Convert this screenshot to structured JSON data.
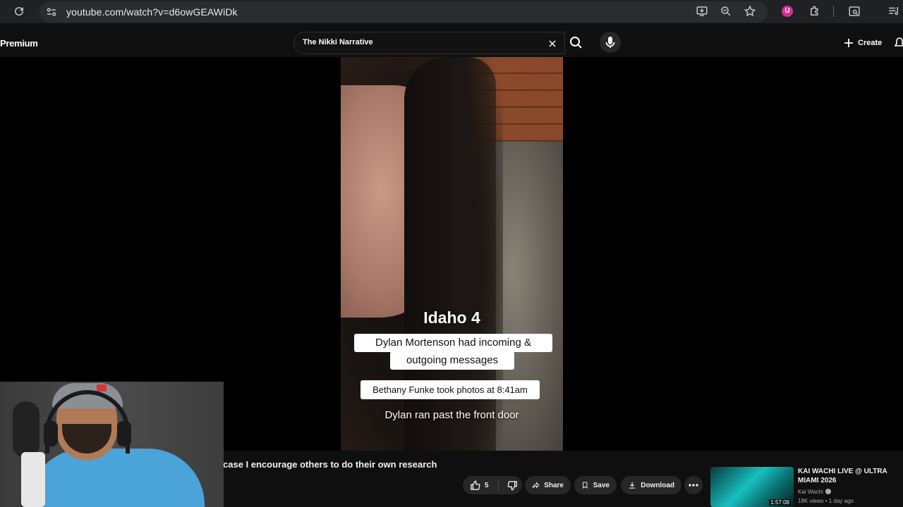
{
  "browser": {
    "url": "youtube.com/watch?v=d6owGEAWiDk",
    "extension_badge": "U"
  },
  "header": {
    "premium_label": "Premium",
    "search_query": "The Nikki Narrative",
    "create_label": "Create"
  },
  "video": {
    "overlay_title": "Idaho 4",
    "captions": [
      "Dylan Mortenson had incoming &",
      "outgoing messages",
      "Bethany Funke took photos at 8:41am",
      "Dylan ran past the front door"
    ]
  },
  "description_snippet": "case I encourage others to do their own research",
  "actions": {
    "like_count": "5",
    "share_label": "Share",
    "save_label": "Save",
    "download_label": "Download"
  },
  "recommendation": {
    "title": "KAI WACHI LIVE @ ULTRA MIAMI 2026",
    "channel": "Kai Wachi",
    "meta": "18K views • 1 day ago",
    "duration": "1:57:08"
  },
  "colors": {
    "background": "#0f0f0f",
    "chrome": "#202124",
    "pill": "#272727"
  }
}
